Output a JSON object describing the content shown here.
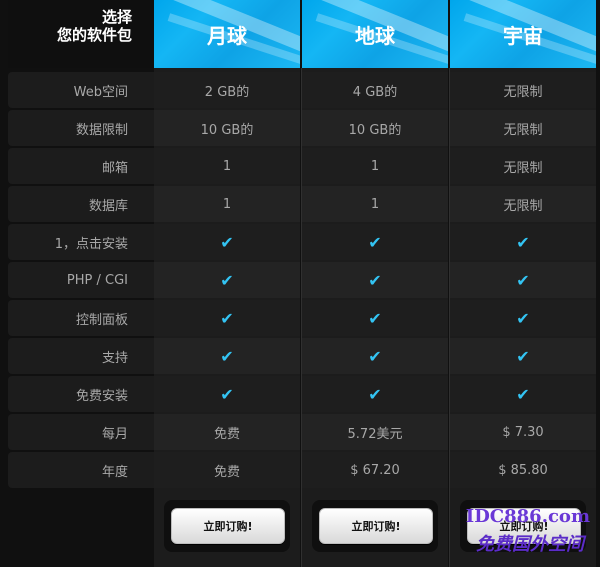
{
  "header": {
    "choose_line1": "选择",
    "choose_line2": "您的软件包",
    "plans": [
      "月球",
      "地球",
      "宇宙"
    ]
  },
  "rows": [
    {
      "label": "Web空间",
      "values": [
        "2 GB的",
        "4 GB的",
        "无限制"
      ]
    },
    {
      "label": "数据限制",
      "values": [
        "10 GB的",
        "10 GB的",
        "无限制"
      ]
    },
    {
      "label": "邮箱",
      "values": [
        "1",
        "1",
        "无限制"
      ]
    },
    {
      "label": "数据库",
      "values": [
        "1",
        "1",
        "无限制"
      ]
    },
    {
      "label": "1，点击安装",
      "values": [
        "✔",
        "✔",
        "✔"
      ]
    },
    {
      "label": "PHP / CGI",
      "values": [
        "✔",
        "✔",
        "✔"
      ]
    },
    {
      "label": "控制面板",
      "values": [
        "✔",
        "✔",
        "✔"
      ]
    },
    {
      "label": "支持",
      "values": [
        "✔",
        "✔",
        "✔"
      ]
    },
    {
      "label": "免费安装",
      "values": [
        "✔",
        "✔",
        "✔"
      ]
    },
    {
      "label": "每月",
      "values": [
        "免费",
        "5.72美元",
        "$ 7.30"
      ]
    },
    {
      "label": "年度",
      "values": [
        "免费",
        "$ 67.20",
        "$ 85.80"
      ]
    }
  ],
  "buttons": {
    "label": "立即订购!"
  },
  "watermark": {
    "line1": "IDC886.com",
    "line2": "免费国外空间"
  },
  "colors": {
    "accent": "#33c4f3",
    "plan_header": "#00a6ec"
  }
}
